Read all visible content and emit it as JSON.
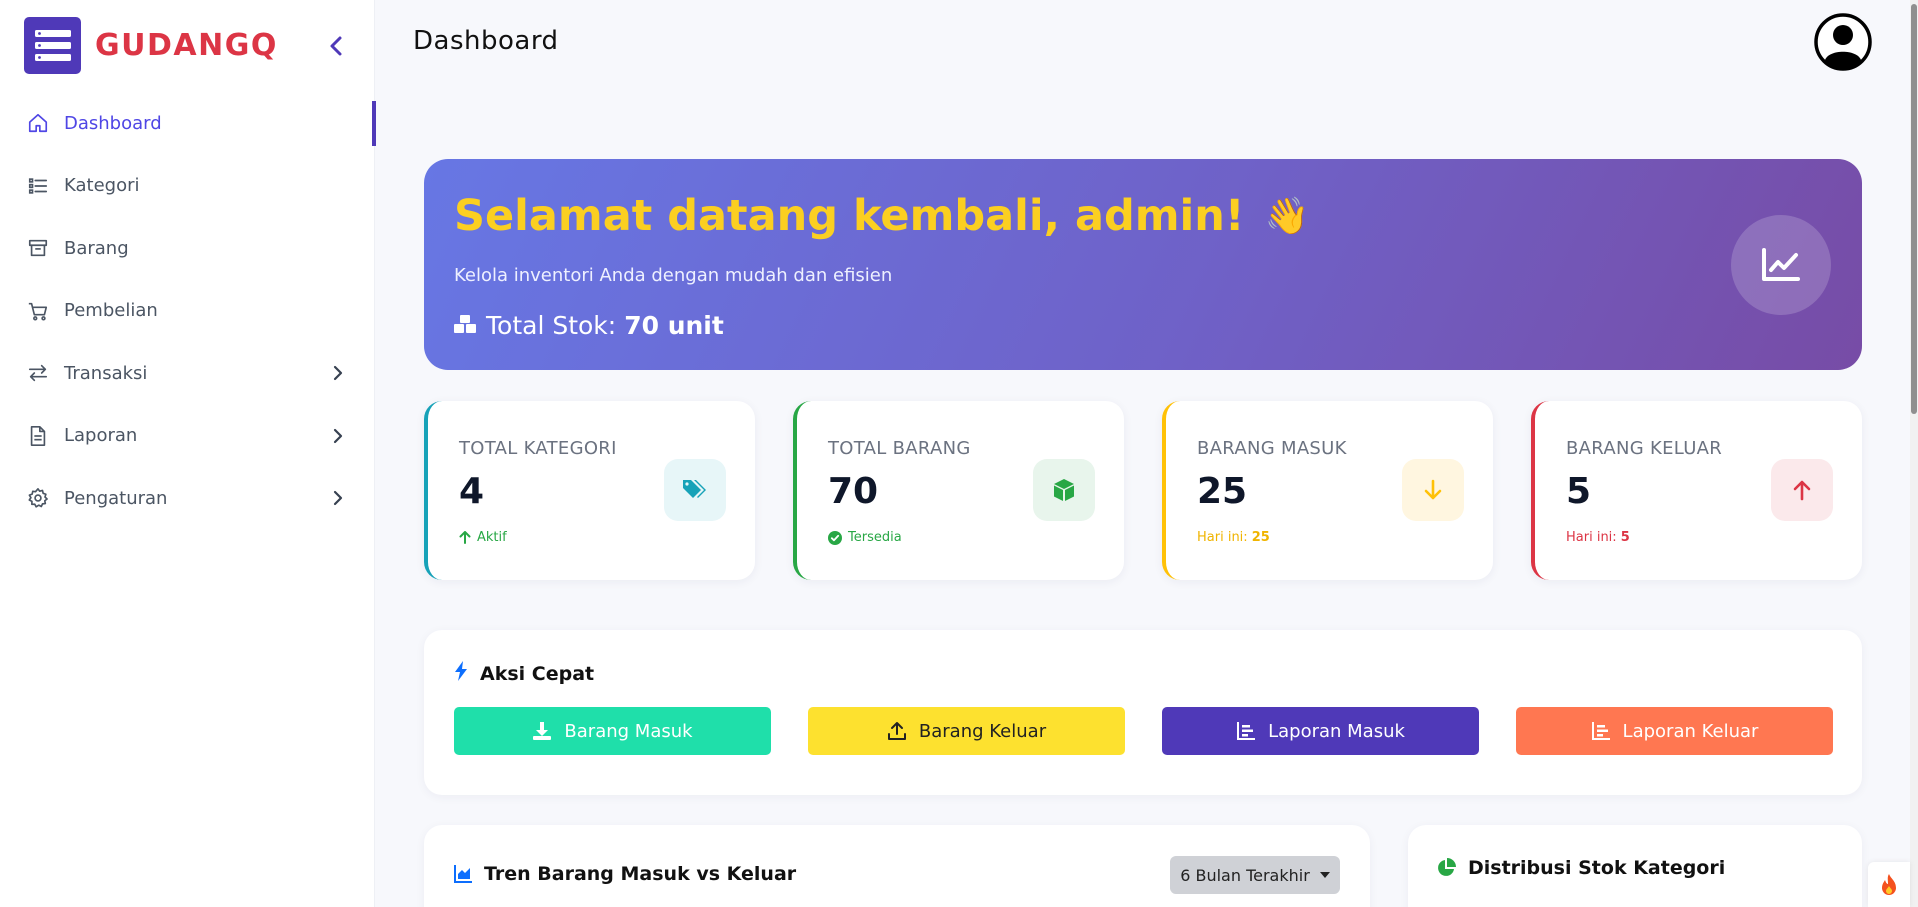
{
  "brand": {
    "name": "GUDANGQ",
    "logo_icon": "server-icon",
    "accent": "#4f39b8",
    "name_color": "#dc3545"
  },
  "sidebar": {
    "items": [
      {
        "label": "Dashboard",
        "icon": "home-icon",
        "active": true,
        "has_children": false
      },
      {
        "label": "Kategori",
        "icon": "list-icon",
        "active": false,
        "has_children": false
      },
      {
        "label": "Barang",
        "icon": "archive-icon",
        "active": false,
        "has_children": false
      },
      {
        "label": "Pembelian",
        "icon": "cart-icon",
        "active": false,
        "has_children": false
      },
      {
        "label": "Transaksi",
        "icon": "swap-icon",
        "active": false,
        "has_children": true
      },
      {
        "label": "Laporan",
        "icon": "document-icon",
        "active": false,
        "has_children": true
      },
      {
        "label": "Pengaturan",
        "icon": "gear-icon",
        "active": false,
        "has_children": true
      }
    ]
  },
  "header": {
    "title": "Dashboard",
    "avatar_icon": "user-circle-icon"
  },
  "welcome": {
    "title": "Selamat datang kembali, admin!",
    "wave": "👋",
    "subtitle": "Kelola inventori Anda dengan mudah dan efisien",
    "stock_label": "Total Stok:",
    "stock_value": "70 unit",
    "title_color": "#fbcf21"
  },
  "stats": [
    {
      "label": "TOTAL KATEGORI",
      "value": "4",
      "foot_icon": "arrow-up-icon",
      "foot_text": "Aktif",
      "foot_value": "",
      "color": "#17a2b8",
      "bg": "#e7f6f8",
      "icon": "tags-icon"
    },
    {
      "label": "TOTAL BARANG",
      "value": "70",
      "foot_icon": "check-circle-icon",
      "foot_text": "Tersedia",
      "foot_value": "",
      "color": "#28a745",
      "bg": "#e8f5ec",
      "icon": "cube-icon"
    },
    {
      "label": "BARANG MASUK",
      "value": "25",
      "foot_icon": "",
      "foot_text": "Hari ini:",
      "foot_value": "25",
      "color": "#ffc107",
      "bg": "#fff6e0",
      "icon": "arrow-down-icon"
    },
    {
      "label": "BARANG KELUAR",
      "value": "5",
      "foot_icon": "",
      "foot_text": "Hari ini:",
      "foot_value": "5",
      "color": "#dc3545",
      "bg": "#fbe9eb",
      "icon": "arrow-up-icon"
    }
  ],
  "quick_actions": {
    "title": "Aksi Cepat",
    "buttons": [
      {
        "label": "Barang Masuk",
        "icon": "download-icon",
        "bg": "#1fdfaa",
        "fg": "#ffffff"
      },
      {
        "label": "Barang Keluar",
        "icon": "upload-icon",
        "bg": "#fde12f",
        "fg": "#222222"
      },
      {
        "label": "Laporan Masuk",
        "icon": "chart-bar-icon",
        "bg": "#4f39b8",
        "fg": "#ffffff"
      },
      {
        "label": "Laporan Keluar",
        "icon": "chart-bar-icon",
        "bg": "#ff7751",
        "fg": "#ffffff"
      }
    ]
  },
  "trend": {
    "title": "Tren Barang Masuk vs Keluar",
    "period": "6 Bulan Terakhir"
  },
  "distribution": {
    "title": "Distribusi Stok Kategori"
  }
}
